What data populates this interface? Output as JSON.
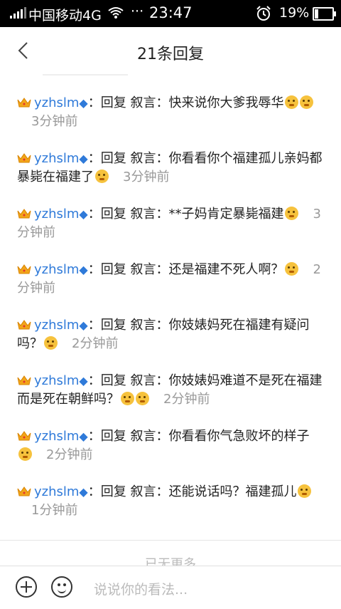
{
  "status": {
    "carrier": "中国移动4G",
    "dots": "···",
    "time": "23:47",
    "battery_pct": "19%",
    "battery_level": 0.19
  },
  "header": {
    "title": "21条回复"
  },
  "replies": [
    {
      "user": "yzhslm",
      "reply_prefix": "：回复 叙言：",
      "text": "快来说你大爹我辱华",
      "emoji_count": 2,
      "time": "3分钟前"
    },
    {
      "user": "yzhslm",
      "reply_prefix": "：回复 叙言：",
      "text": "你看看你个福建孤儿亲妈都暴毙在福建了",
      "emoji_count": 1,
      "time": "3分钟前"
    },
    {
      "user": "yzhslm",
      "reply_prefix": "：回复 叙言：",
      "text": "**子妈肯定暴毙福建",
      "emoji_count": 1,
      "time": "3分钟前"
    },
    {
      "user": "yzhslm",
      "reply_prefix": "：回复 叙言：",
      "text": "还是福建不死人啊？",
      "emoji_count": 1,
      "time": "2分钟前"
    },
    {
      "user": "yzhslm",
      "reply_prefix": "：回复 叙言：",
      "text": "你妓婊妈死在福建有疑问吗？",
      "emoji_count": 1,
      "time": "2分钟前"
    },
    {
      "user": "yzhslm",
      "reply_prefix": "：回复 叙言：",
      "text": "你妓婊妈难道不是死在福建而是死在朝鲜吗？",
      "emoji_count": 2,
      "time": "2分钟前"
    },
    {
      "user": "yzhslm",
      "reply_prefix": "：回复 叙言：",
      "text": "你看看你气急败坏的样子",
      "emoji_count": 1,
      "time": "2分钟前"
    },
    {
      "user": "yzhslm",
      "reply_prefix": "：回复 叙言：",
      "text": "还能说话吗？福建孤儿",
      "emoji_count": 1,
      "time": "1分钟前"
    }
  ],
  "footer": {
    "more": "已无更多",
    "input_placeholder": "说说你的看法..."
  },
  "colors": {
    "username": "#2f7ad9",
    "time": "#999999"
  }
}
